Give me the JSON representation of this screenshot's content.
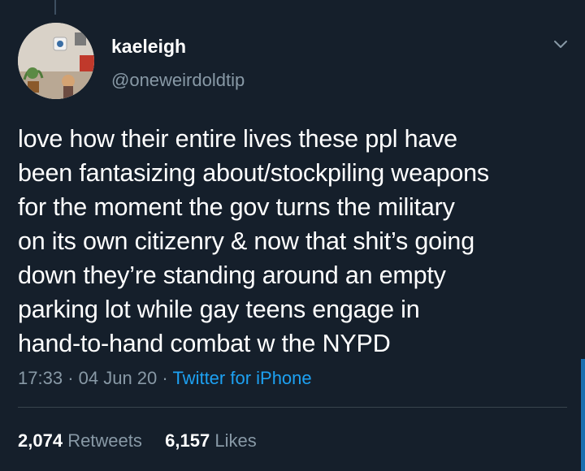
{
  "tweet": {
    "display_name": "kaeleigh",
    "handle": "@oneweirdoldtip",
    "text": "love how their entire lives these ppl have\nbeen fantasizing about/stockpiling weapons\nfor the moment the gov turns the military\non its own citizenry & now that shit’s going\ndown they’re standing around an empty\nparking lot while gay teens engage in\nhand-to-hand combat w the NYPD",
    "time": "17:33",
    "date": "04 Jun 20",
    "separator": "·",
    "source": "Twitter for iPhone"
  },
  "stats": {
    "retweets_count": "2,074",
    "retweets_label": "Retweets",
    "likes_count": "6,157",
    "likes_label": "Likes"
  },
  "colors": {
    "background": "#151f2b",
    "secondary_text": "#8899a6",
    "link": "#1da1f2"
  },
  "icons": {
    "menu": "chevron-down-icon"
  }
}
